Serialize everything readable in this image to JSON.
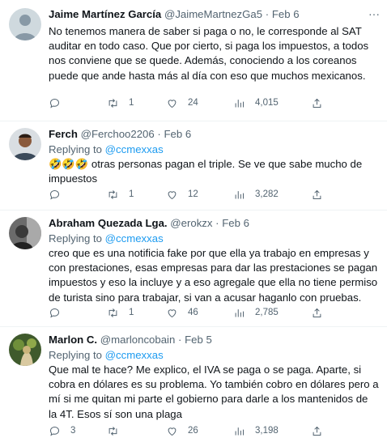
{
  "tweets": [
    {
      "name": "Jaime Martínez García",
      "handle": "@JaimeMartnezGa5",
      "dot": "·",
      "time": "Feb 6",
      "replying_prefix": "",
      "replying_to": "",
      "body_prefix": "",
      "body": "No tenemos manera de saber si paga o no, le corresponde al SAT auditar en todo caso. Que por cierto, si paga los impuestos, a todos nos conviene que se quede. Además, conociendo a los coreanos puede que ande hasta más al día con eso que muchos mexicanos.",
      "replies": "",
      "retweets": "1",
      "likes": "24",
      "views": "4,015"
    },
    {
      "name": "Ferch",
      "handle": "@Ferchoo2206",
      "dot": "·",
      "time": "Feb 6",
      "replying_prefix": "Replying to",
      "replying_to": "@ccmexxas",
      "body_prefix": "🤣🤣🤣",
      "body": " otras personas pagan el triple.  Se ve que sabe mucho de impuestos",
      "replies": "",
      "retweets": "1",
      "likes": "12",
      "views": "3,282"
    },
    {
      "name": "Abraham Quezada Lga.",
      "handle": "@erokzx",
      "dot": "·",
      "time": "Feb 6",
      "replying_prefix": "Replying to",
      "replying_to": "@ccmexxas",
      "body_prefix": "",
      "body": "creo que es una notificia fake por que ella ya trabajo en empresas y con prestaciones, esas empresas para dar las prestaciones se pagan impuestos y eso la incluye y a eso agregale que ella no tiene permiso de turista sino para trabajar, si van a acusar haganlo con pruebas.",
      "replies": "",
      "retweets": "1",
      "likes": "46",
      "views": "2,785"
    },
    {
      "name": "Marlon C.",
      "handle": "@marloncobain",
      "dot": "·",
      "time": "Feb 5",
      "replying_prefix": "Replying to",
      "replying_to": "@ccmexxas",
      "body_prefix": "",
      "body": "Que mal te hace? Me explico, el IVA se paga o se paga. Aparte, si cobra en dólares es su problema. Yo también cobro en dólares pero a mí si me quitan mi parte el gobierno para darle a los mantenidos de la 4T. Esos sí son una plaga",
      "replies": "3",
      "retweets": "",
      "likes": "26",
      "views": "3,198"
    }
  ],
  "icons": {
    "reply": "reply-icon",
    "retweet": "retweet-icon",
    "like": "heart-icon",
    "views": "views-chart-icon",
    "share": "share-icon",
    "more": "more-icon"
  },
  "colors": {
    "link": "#1d9bf0",
    "secondary_text": "#536471",
    "divider": "#eff3f4"
  }
}
